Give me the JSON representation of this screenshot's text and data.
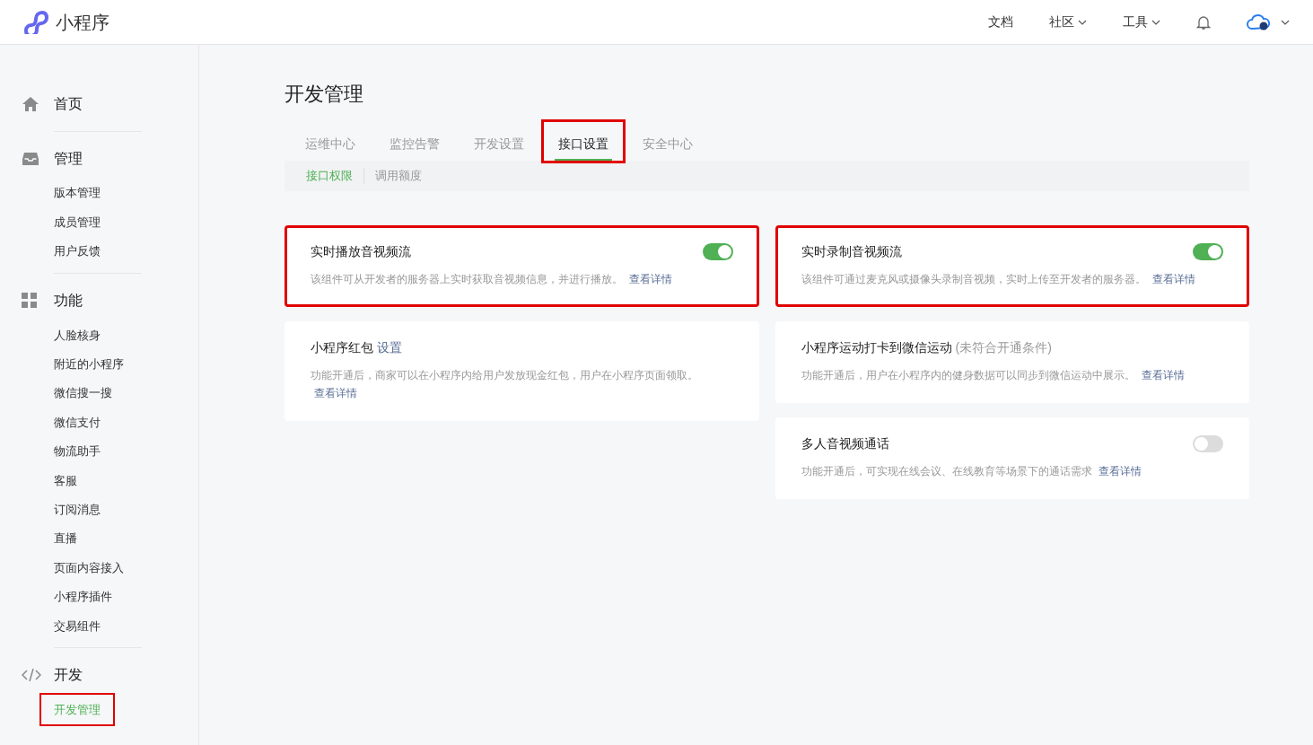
{
  "header": {
    "logo_text": "小程序",
    "nav": [
      {
        "label": "文档",
        "dropdown": false
      },
      {
        "label": "社区",
        "dropdown": true
      },
      {
        "label": "工具",
        "dropdown": true
      }
    ]
  },
  "sidebar": {
    "sections": [
      {
        "kind": "home",
        "label": "首页"
      },
      {
        "kind": "inbox",
        "label": "管理",
        "items": [
          {
            "label": "版本管理",
            "selected": false,
            "highlighted": false
          },
          {
            "label": "成员管理",
            "selected": false,
            "highlighted": false
          },
          {
            "label": "用户反馈",
            "selected": false,
            "highlighted": false
          }
        ]
      },
      {
        "kind": "grid",
        "label": "功能",
        "items": [
          {
            "label": "人脸核身",
            "selected": false,
            "highlighted": false
          },
          {
            "label": "附近的小程序",
            "selected": false,
            "highlighted": false
          },
          {
            "label": "微信搜一搜",
            "selected": false,
            "highlighted": false
          },
          {
            "label": "微信支付",
            "selected": false,
            "highlighted": false
          },
          {
            "label": "物流助手",
            "selected": false,
            "highlighted": false
          },
          {
            "label": "客服",
            "selected": false,
            "highlighted": false
          },
          {
            "label": "订阅消息",
            "selected": false,
            "highlighted": false
          },
          {
            "label": "直播",
            "selected": false,
            "highlighted": false
          },
          {
            "label": "页面内容接入",
            "selected": false,
            "highlighted": false
          },
          {
            "label": "小程序插件",
            "selected": false,
            "highlighted": false
          },
          {
            "label": "交易组件",
            "selected": false,
            "highlighted": false
          }
        ]
      },
      {
        "kind": "code",
        "label": "开发",
        "items": [
          {
            "label": "开发管理",
            "selected": true,
            "highlighted": true
          }
        ]
      }
    ]
  },
  "page_title": "开发管理",
  "tabs": [
    {
      "label": "运维中心",
      "selected": false,
      "highlighted": false
    },
    {
      "label": "监控告警",
      "selected": false,
      "highlighted": false
    },
    {
      "label": "开发设置",
      "selected": false,
      "highlighted": false
    },
    {
      "label": "接口设置",
      "selected": true,
      "highlighted": true
    },
    {
      "label": "安全中心",
      "selected": false,
      "highlighted": false
    }
  ],
  "subtabs": [
    {
      "label": "接口权限",
      "selected": true
    },
    {
      "label": "调用额度",
      "selected": false
    }
  ],
  "columns": [
    [
      {
        "title": "实时播放音视频流",
        "toggle": {
          "on": true
        },
        "description": "该组件可从开发者的服务器上实时获取音视频信息，并进行播放。",
        "link": "查看详情",
        "highlighted": true
      },
      {
        "title": "小程序红包",
        "title_link": "设置",
        "description": "功能开通后，商家可以在小程序内给用户发放现金红包，用户在小程序页面领取。",
        "link": "查看详情",
        "highlighted": false
      }
    ],
    [
      {
        "title": "实时录制音视频流",
        "toggle": {
          "on": true
        },
        "description": "该组件可通过麦克风或摄像头录制音视频，实时上传至开发者的服务器。",
        "link": "查看详情",
        "highlighted": true
      },
      {
        "title": "小程序运动打卡到微信运动",
        "title_note": "(未符合开通条件)",
        "description": "功能开通后，用户在小程序内的健身数据可以同步到微信运动中展示。",
        "link": "查看详情",
        "highlighted": false
      },
      {
        "title": "多人音视频通话",
        "toggle": {
          "on": false
        },
        "description": "功能开通后，可实现在线会议、在线教育等场景下的通话需求",
        "link": "查看详情",
        "highlighted": false
      }
    ]
  ]
}
